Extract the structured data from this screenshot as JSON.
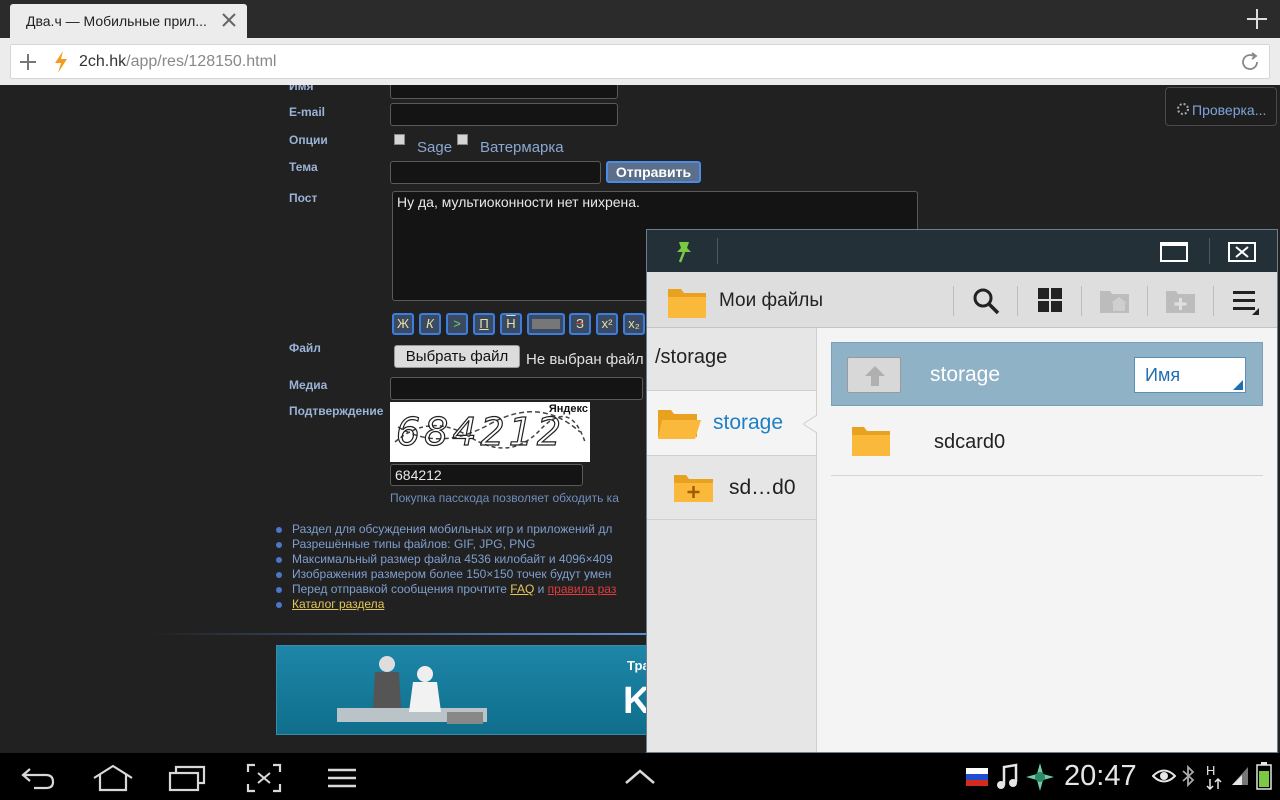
{
  "browser": {
    "tab_title": "Два.ч — Мобильные прил...",
    "url_host": "2ch.hk",
    "url_path": "/app/res/128150.html"
  },
  "form": {
    "labels": {
      "name": "Имя",
      "email": "E-mail",
      "options": "Опции",
      "subject": "Тема",
      "post": "Пост",
      "file": "Файл",
      "media": "Медиа",
      "confirm": "Подтверждение"
    },
    "sage_label": "Sage",
    "watermark_label": "Ватермарка",
    "send_button": "Отправить",
    "post_text": "Ну да, мультиоконности нет нихрена.",
    "format_buttons": [
      "Ж",
      "К",
      ">",
      "П",
      "Н",
      "",
      "З",
      "x²",
      "x₂"
    ],
    "file_button": "Выбрать файл",
    "file_status": "Не выбран файл",
    "captcha_text": "684212",
    "captcha_logo": "Яндекс",
    "captcha_value": "684212",
    "passcode_text": "Покупка пасскода позволяет обходить ка"
  },
  "check_button": "Проверка...",
  "rules": [
    "Раздел для обсуждения мобильных игр и приложений дл",
    "Разрешённые типы файлов: GIF, JPG, PNG",
    "Максимальный размер файла 4536 килобайт и 4096×409",
    "Изображения размером более 150×150 точек будут умен"
  ],
  "rule5": {
    "before": "Перед отправкой сообщения прочтите ",
    "faq": "FAQ",
    "and": " и ",
    "rules_link": "правила раз"
  },
  "catalog_link": "Каталог раздела",
  "banner": {
    "title": "Тра",
    "letter": "K"
  },
  "file_manager": {
    "app_name": "Мои файлы",
    "current_path": "/storage",
    "nav": [
      {
        "label": "storage",
        "active": true
      },
      {
        "label": "sd…d0",
        "active": false
      }
    ],
    "current_folder": "storage",
    "sort_label": "Имя",
    "items": [
      {
        "name": "sdcard0"
      }
    ]
  },
  "status_bar": {
    "time": "20:47"
  },
  "colors": {
    "accent": "#1f7fc4",
    "page_bg": "#212121",
    "label": "#9ab3d6"
  }
}
